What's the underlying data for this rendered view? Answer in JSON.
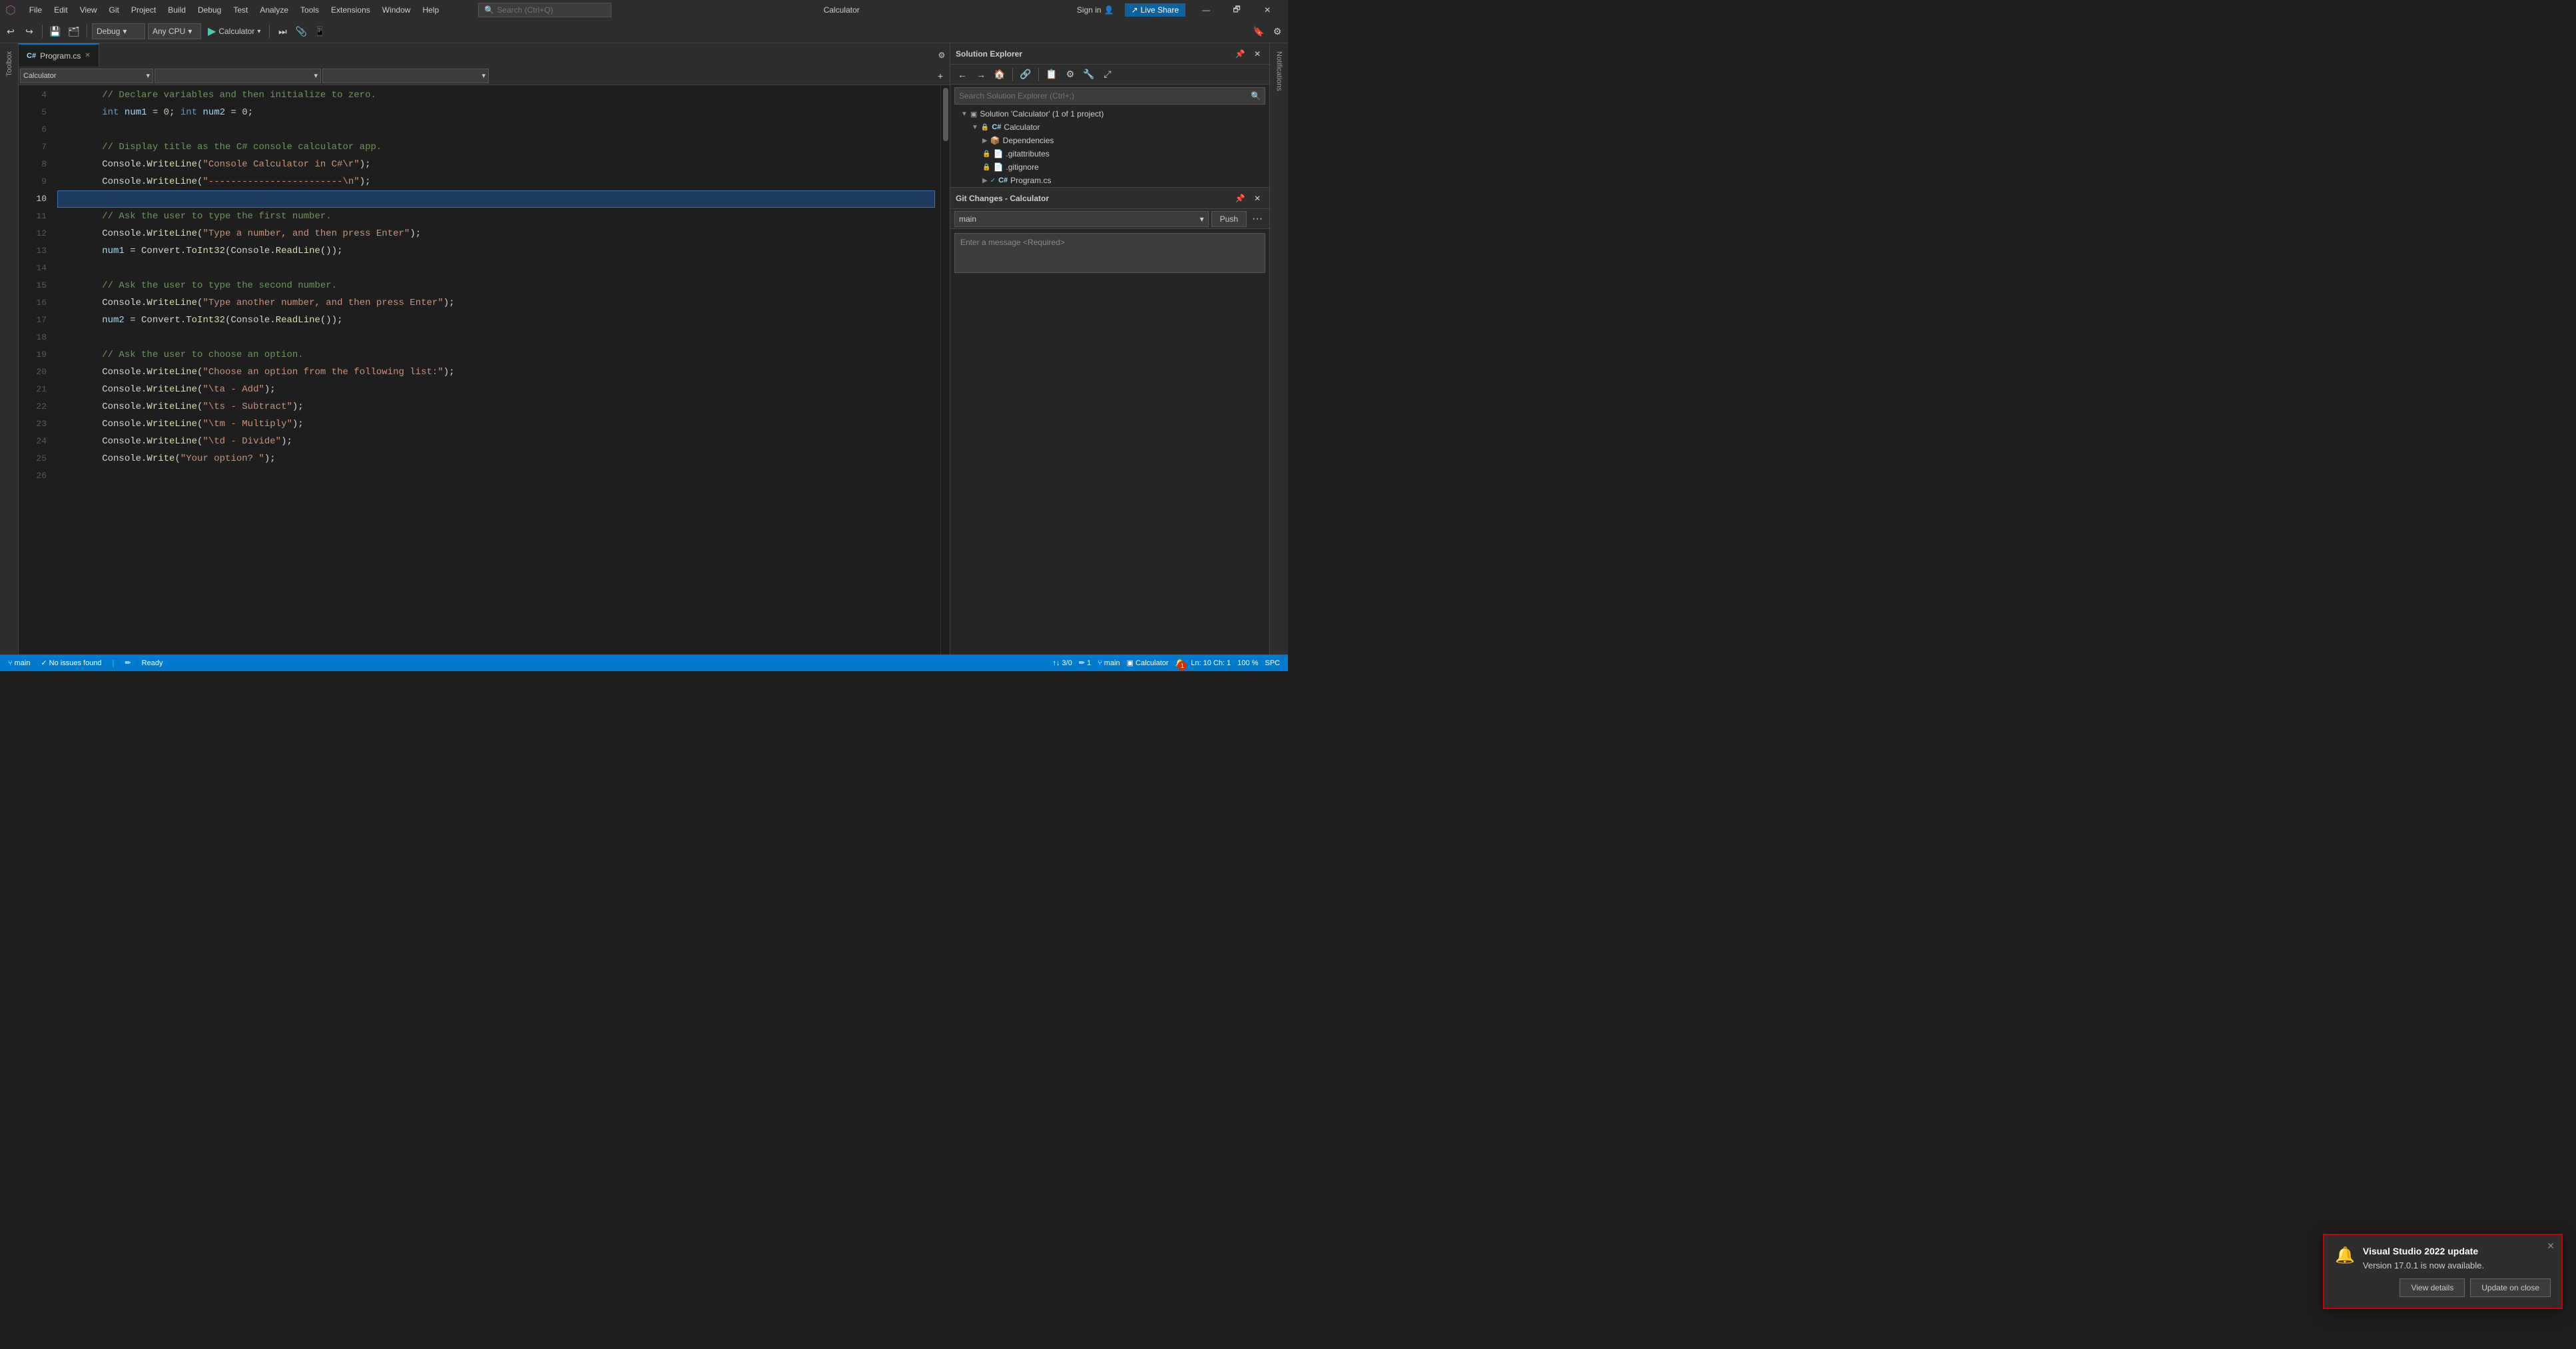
{
  "titlebar": {
    "vs_icon": "⚙",
    "menus": [
      "File",
      "Edit",
      "View",
      "Git",
      "Project",
      "Build",
      "Debug",
      "Test",
      "Analyze",
      "Tools",
      "Extensions",
      "Window",
      "Help"
    ],
    "search_placeholder": "Search (Ctrl+Q)",
    "app_title": "Calculator",
    "sign_in": "Sign in",
    "live_share": "Live Share",
    "minimize": "—",
    "restore": "🗗",
    "close": "✕"
  },
  "toolbar": {
    "debug_config": "Debug",
    "platform": "Any CPU",
    "run_label": "Calculator",
    "play_icon": "▶"
  },
  "tabs": [
    {
      "label": "Program.cs",
      "active": true
    }
  ],
  "nav": {
    "scope": "Calculator",
    "class": "",
    "member": ""
  },
  "code": {
    "lines": [
      {
        "num": 4,
        "content": "        // Declare variables and then initialize to zero.",
        "type": "comment"
      },
      {
        "num": 5,
        "content": "        int num1 = 0; int num2 = 0;",
        "type": "code"
      },
      {
        "num": 6,
        "content": "",
        "type": "plain"
      },
      {
        "num": 7,
        "content": "        // Display title as the C# console calculator app.",
        "type": "comment"
      },
      {
        "num": 8,
        "content": "        Console.WriteLine(\"Console Calculator in C#\\r\");",
        "type": "code"
      },
      {
        "num": 9,
        "content": "        Console.WriteLine(\"------------------------\\n\");",
        "type": "code"
      },
      {
        "num": 10,
        "content": "",
        "type": "selected"
      },
      {
        "num": 11,
        "content": "        // Ask the user to type the first number.",
        "type": "comment"
      },
      {
        "num": 12,
        "content": "        Console.WriteLine(\"Type a number, and then press Enter\");",
        "type": "code"
      },
      {
        "num": 13,
        "content": "        num1 = Convert.ToInt32(Console.ReadLine());",
        "type": "code"
      },
      {
        "num": 14,
        "content": "",
        "type": "plain"
      },
      {
        "num": 15,
        "content": "        // Ask the user to type the second number.",
        "type": "comment"
      },
      {
        "num": 16,
        "content": "        Console.WriteLine(\"Type another number, and then press Enter\");",
        "type": "code"
      },
      {
        "num": 17,
        "content": "        num2 = Convert.ToInt32(Console.ReadLine());",
        "type": "code"
      },
      {
        "num": 18,
        "content": "",
        "type": "plain"
      },
      {
        "num": 19,
        "content": "        // Ask the user to choose an option.",
        "type": "comment"
      },
      {
        "num": 20,
        "content": "        Console.WriteLine(\"Choose an option from the following list:\");",
        "type": "code"
      },
      {
        "num": 21,
        "content": "        Console.WriteLine(\"\\ta - Add\");",
        "type": "code"
      },
      {
        "num": 22,
        "content": "        Console.WriteLine(\"\\ts - Subtract\");",
        "type": "code"
      },
      {
        "num": 23,
        "content": "        Console.WriteLine(\"\\tm - Multiply\");",
        "type": "code"
      },
      {
        "num": 24,
        "content": "        Console.WriteLine(\"\\td - Divide\");",
        "type": "code"
      },
      {
        "num": 25,
        "content": "        Console.Write(\"Your option? \");",
        "type": "code"
      },
      {
        "num": 26,
        "content": "",
        "type": "plain"
      }
    ]
  },
  "solution_explorer": {
    "title": "Solution Explorer",
    "search_placeholder": "Search Solution Explorer (Ctrl+;)",
    "tree": [
      {
        "indent": 1,
        "label": "Solution 'Calculator' (1 of 1 project)",
        "icon": "solution",
        "expanded": true
      },
      {
        "indent": 2,
        "label": "Calculator",
        "icon": "project",
        "expanded": true,
        "locked": true
      },
      {
        "indent": 3,
        "label": "Dependencies",
        "icon": "folder",
        "expanded": false
      },
      {
        "indent": 3,
        "label": ".gitattributes",
        "icon": "file",
        "locked": true
      },
      {
        "indent": 3,
        "label": ".gitignore",
        "icon": "file",
        "locked": true
      },
      {
        "indent": 3,
        "label": "Program.cs",
        "icon": "cs",
        "locked": false
      }
    ]
  },
  "git_changes": {
    "title": "Git Changes - Calculator",
    "branch": "main",
    "push_label": "Push",
    "more": "···",
    "commit_placeholder": "Enter a message <Required>"
  },
  "status_bar": {
    "ready": "Ready",
    "git_icon": "⑂",
    "no_issues": "No issues found",
    "check_icon": "✓",
    "zoom": "100 %",
    "line": "Ln: 10",
    "col": "Ch: 1",
    "encoding": "SPC",
    "branch_label": "main",
    "solution_label": "Calculator",
    "notif_count": "1",
    "git_changes_count": "3/0"
  },
  "notification": {
    "title": "Visual Studio 2022 update",
    "description": "Version 17.0.1 is now available.",
    "view_details": "View details",
    "update_on_close": "Update on close",
    "bell_icon": "🔔"
  },
  "notifications_side": {
    "label": "Notifications"
  }
}
